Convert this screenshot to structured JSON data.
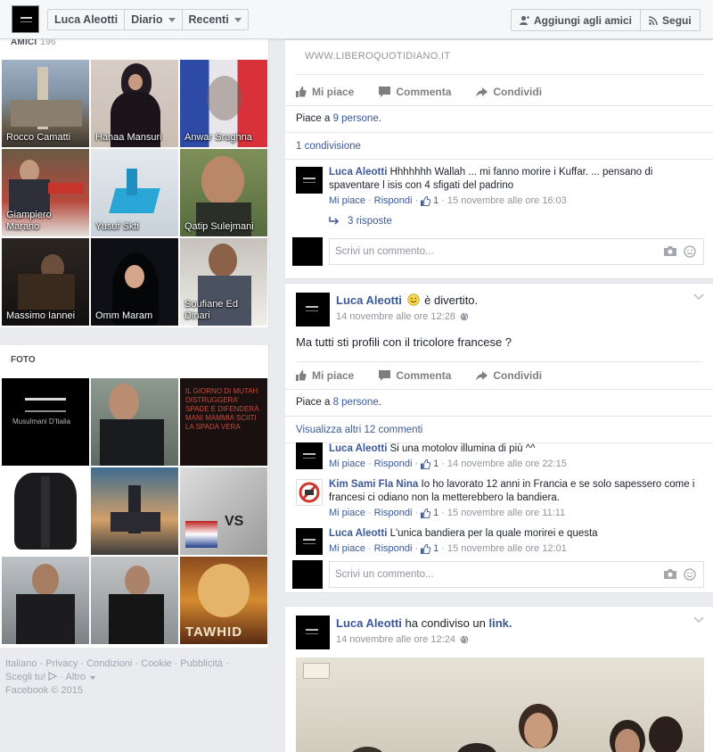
{
  "topbar": {
    "name": "Luca Aleotti",
    "diario": "Diario",
    "recenti": "Recenti",
    "add_friend": "Aggiungi agli amici",
    "follow": "Segui"
  },
  "friends": {
    "title": "AMICI",
    "count": "196",
    "items": [
      {
        "name": "Rocco Camatti"
      },
      {
        "name": "Hanaa Mansuri"
      },
      {
        "name": "Anwar Sraghna"
      },
      {
        "name": "Giampiero Marano"
      },
      {
        "name": "Yusuf Skti"
      },
      {
        "name": "Qatip Sulejmani"
      },
      {
        "name": "Massimo Iannei"
      },
      {
        "name": "Omm Maram"
      },
      {
        "name": "Soufiane Ed Dinari"
      }
    ]
  },
  "photos": {
    "title": "FOTO",
    "photo1_caption": "Musulmani D'Italia",
    "photo3_caption": "IL GIORNO DI MUTAH DISTRUGGERA' SPADE E DIFENDERÀ MANI MAMMIA SCIITI LA SPADA VERA",
    "photo5_caption": "VS",
    "photo9_caption": "TAWHID"
  },
  "footer": {
    "links": [
      "Italiano",
      "Privacy",
      "Condizioni",
      "Cookie",
      "Pubblicità"
    ],
    "scegli": "Scegli tu!",
    "altro": "Altro",
    "copyright": "Facebook © 2015"
  },
  "post1": {
    "link_url": "WWW.LIBEROQUOTIDIANO.IT",
    "like_label": "Mi piace",
    "comment_label": "Commenta",
    "share_label": "Condividi",
    "likes_prefix": "Piace a ",
    "likes_count": "9 persone",
    "shares": "1 condivisione",
    "comment": {
      "author": "Luca Aleotti",
      "text": "Hhhhhhh Wallah ... mi fanno morire i Kuffar. ... pensano di spaventare l isis con 4 sfigati del padrino",
      "like": "Mi piace",
      "reply": "Rispondi",
      "likes": "1",
      "time": "15 novembre alle ore 16:03",
      "replies": "3 risposte"
    },
    "input_placeholder": "Scrivi un commento..."
  },
  "post2": {
    "author": "Luca Aleotti",
    "feeling": "è divertito.",
    "time": "14 novembre alle ore 12:28",
    "text": "Ma tutti sti profili con il tricolore francese ?",
    "like_label": "Mi piace",
    "comment_label": "Commenta",
    "share_label": "Condividi",
    "likes_prefix": "Piace a ",
    "likes_count": "8 persone",
    "more_comments": "Visualizza altri 12 commenti",
    "comments": [
      {
        "author": "Luca Aleotti",
        "text": "Si una motolov illumina di più ^^",
        "like": "Mi piace",
        "reply": "Rispondi",
        "likes": "1",
        "time": "14 novembre alle ore 22:15"
      },
      {
        "author": "Kim Sami Fla Nina",
        "text": "Io ho lavorato 12 anni in Francia e se solo sapessero come i francesi ci odiano non la metterebbero la bandiera.",
        "like": "Mi piace",
        "reply": "Rispondi",
        "likes": "1",
        "time": "15 novembre alle ore 11:11"
      },
      {
        "author": "Luca Aleotti",
        "text": "L'unica bandiera per la quale morirei e questa",
        "like": "Mi piace",
        "reply": "Rispondi",
        "likes": "1",
        "time": "15 novembre alle ore 12:01"
      }
    ],
    "input_placeholder": "Scrivi un commento..."
  },
  "post3": {
    "author": "Luca Aleotti",
    "action": "ha condiviso un",
    "link_word": "link.",
    "time": "14 novembre alle ore 12:24"
  },
  "colors": {
    "link": "#3b5998",
    "background": "#e9ebee",
    "meta": "#90949c"
  }
}
